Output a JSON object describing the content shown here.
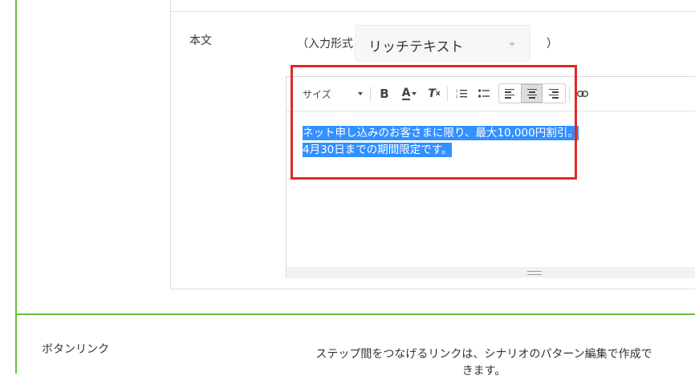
{
  "form": {
    "body_label": "本文",
    "input_format_open": "（入力形式",
    "input_format_close": "）",
    "input_format_value": "リッチテキスト",
    "button_link_label": "ボタンリンク",
    "button_link_note": "ステップ間をつなげるリンクは、シナリオのパターン編集で作成できます。"
  },
  "toolbar": {
    "size_label": "サイズ",
    "bold_label": "B",
    "font_color_label": "A",
    "clear_format_label": "T",
    "clear_format_sub": "x",
    "icons": [
      "bold-icon",
      "font-color-icon",
      "clear-format-icon",
      "ordered-list-icon",
      "bullet-list-icon",
      "align-left-icon",
      "align-center-icon",
      "align-right-icon",
      "link-icon"
    ]
  },
  "editor": {
    "lines": [
      "ネット申し込みのお客さまに限り、最大10,000円割引。",
      "4月30日までの期間限定です。"
    ]
  },
  "colors": {
    "accent_green": "#6cbf3a",
    "highlight_red": "#e02a26",
    "selection_blue": "#3390ff"
  }
}
